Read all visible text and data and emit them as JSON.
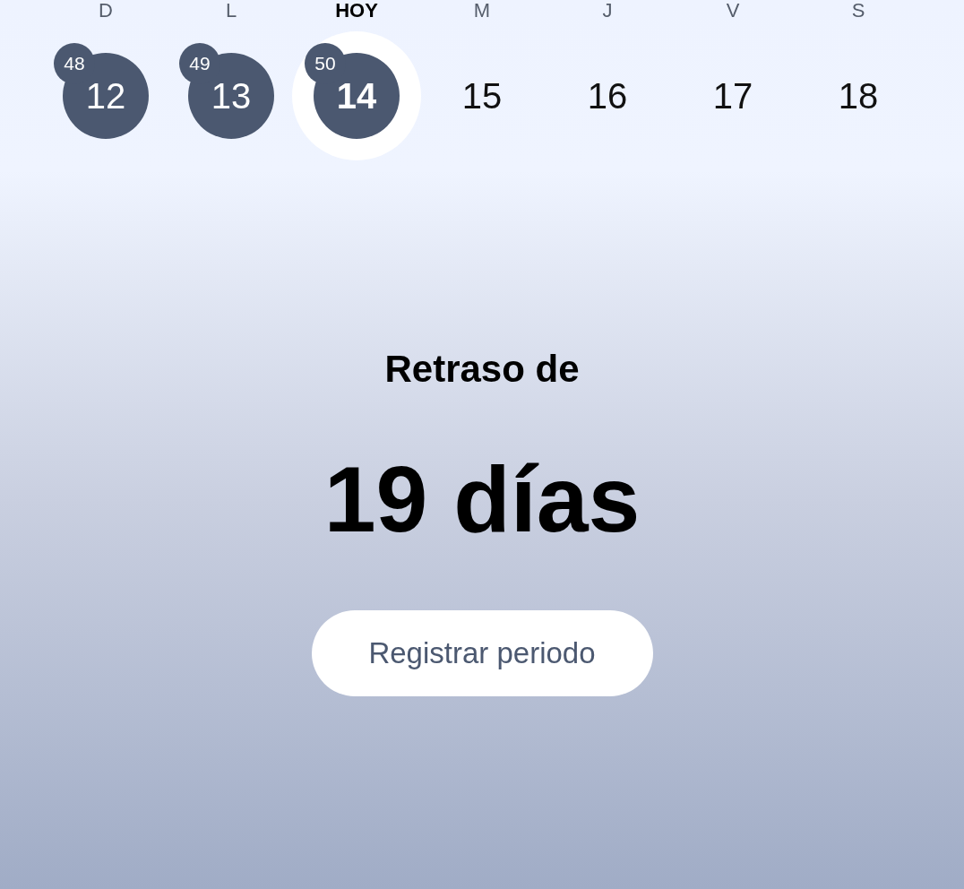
{
  "week": [
    {
      "weekday": "D",
      "date": "12",
      "cycle_day": "48",
      "kind": "logged",
      "selected": false
    },
    {
      "weekday": "L",
      "date": "13",
      "cycle_day": "49",
      "kind": "logged",
      "selected": false
    },
    {
      "weekday": "HOY",
      "date": "14",
      "cycle_day": "50",
      "kind": "logged",
      "selected": true
    },
    {
      "weekday": "M",
      "date": "15",
      "kind": "future",
      "selected": false
    },
    {
      "weekday": "J",
      "date": "16",
      "kind": "future",
      "selected": false
    },
    {
      "weekday": "V",
      "date": "17",
      "kind": "future",
      "selected": false
    },
    {
      "weekday": "S",
      "date": "18",
      "kind": "future",
      "selected": false
    }
  ],
  "status": {
    "label": "Retraso de",
    "value": "19 días"
  },
  "action_button": "Registrar periodo"
}
